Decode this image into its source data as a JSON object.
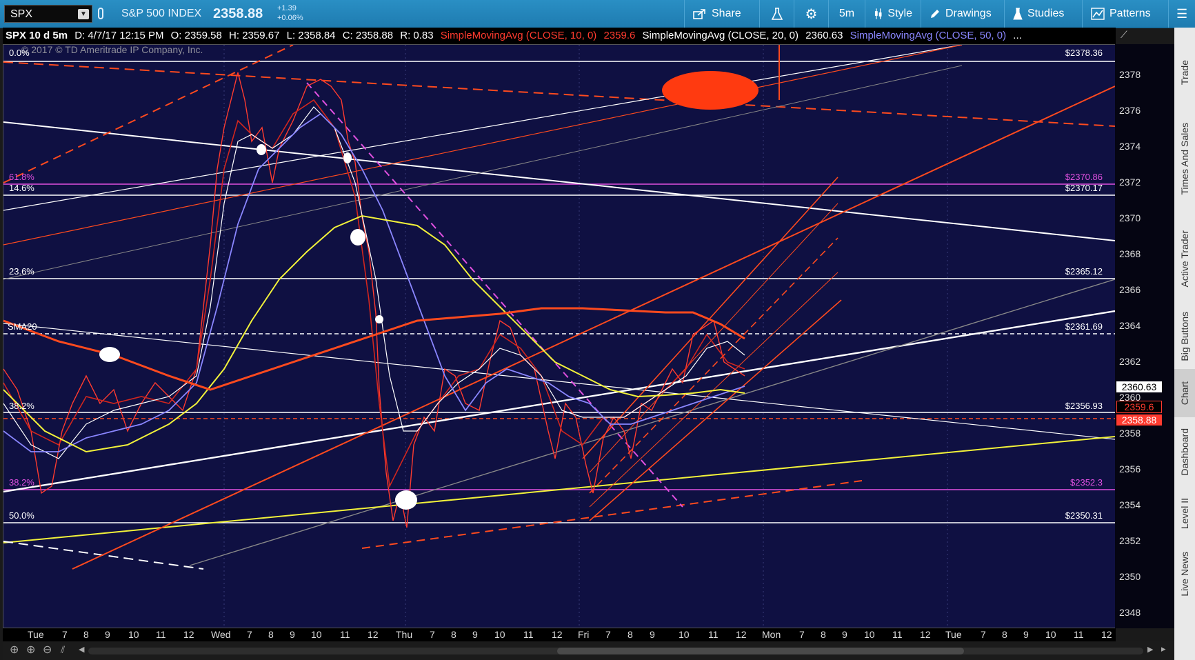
{
  "toolbar": {
    "symbol": "SPX",
    "index_name": "S&P 500 INDEX",
    "last_price": "2358.88",
    "change_abs": "+1.39",
    "change_pct": "+0.06%",
    "share": "Share",
    "interval": "5m",
    "style": "Style",
    "drawings": "Drawings",
    "studies": "Studies",
    "patterns": "Patterns"
  },
  "studybar": {
    "chart_label": "SPX 10 d 5m",
    "date": "D: 4/7/17 12:15 PM",
    "open": "O: 2359.58",
    "high": "H: 2359.67",
    "low": "L: 2358.84",
    "close": "C: 2358.88",
    "range": "R: 0.83",
    "sma10_label": "SimpleMovingAvg (CLOSE, 10, 0)",
    "sma10_value": "2359.6",
    "sma20_label": "SimpleMovingAvg (CLOSE, 20, 0)",
    "sma20_value": "2360.63",
    "sma50_label": "SimpleMovingAvg (CLOSE, 50, 0)",
    "more": "..."
  },
  "chart": {
    "copyright": "© 2017 © TD Ameritrade IP Company, Inc.",
    "fib_left_labels": [
      "0.0%",
      "61.8%",
      "14.6%",
      "23.6%",
      "SMA20",
      "38.2%",
      "38.2%",
      "50.0%"
    ],
    "right_price_labels": [
      "$2378.36",
      "$2370.86",
      "$2370.17",
      "$2365.12",
      "$2361.69",
      "$2356.93",
      "$2352.3",
      "$2350.31"
    ],
    "y_axis_ticks": [
      "2378",
      "2376",
      "2374",
      "2372",
      "2370",
      "2368",
      "2366",
      "2364",
      "2362",
      "2360",
      "2358",
      "2356",
      "2354",
      "2352",
      "2350",
      "2348"
    ],
    "price_tags": [
      "2360.63",
      "2359.6",
      "2358.88"
    ],
    "x_axis_labels": [
      "Tue",
      "7",
      "8",
      "9",
      "10",
      "11",
      "12",
      "Wed",
      "7",
      "8",
      "9",
      "10",
      "11",
      "12",
      "Thu",
      "7",
      "8",
      "9",
      "10",
      "11",
      "12",
      "Fri",
      "7",
      "8",
      "9",
      "10",
      "11",
      "12",
      "Mon",
      "7",
      "8",
      "9",
      "10",
      "11",
      "12",
      "Tue",
      "7",
      "8",
      "9",
      "10",
      "11",
      "12"
    ]
  },
  "right_tabs": [
    "Trade",
    "Times And Sales",
    "Active Trader",
    "Big Buttons",
    "Chart",
    "Dashboard",
    "Level II",
    "Live News"
  ],
  "colors": {
    "toolbar": "#1e7bb0",
    "chart_bg": "#0f1042",
    "sma10": "#e8322a",
    "sma20": "#ffffff",
    "sma50": "#8a86ff",
    "yellow": "#f2f23a",
    "fib_magenta": "#e050e0",
    "orange": "#ff4a1e"
  }
}
